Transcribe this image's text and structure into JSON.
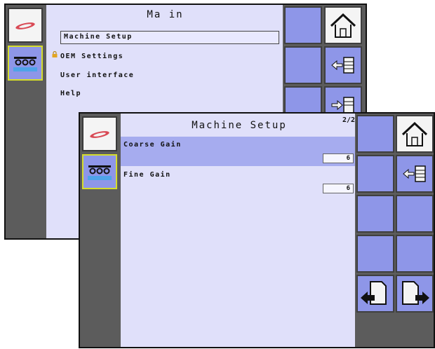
{
  "back_screen": {
    "title": "Ma in",
    "menu": [
      {
        "label": "Machine Setup",
        "selected": true,
        "locked": false
      },
      {
        "label": "OEM Settings",
        "selected": false,
        "locked": true
      },
      {
        "label": "User interface",
        "selected": false,
        "locked": false
      },
      {
        "label": "Help",
        "selected": false,
        "locked": false
      }
    ],
    "left_icons": [
      "sprayer-logo-icon",
      "boom-nozzles-icon"
    ],
    "right_icons": [
      "home-icon",
      "collapse-list-icon",
      "expand-list-icon"
    ]
  },
  "front_screen": {
    "title": "Machine Setup",
    "page_indicator": "2/2",
    "params": [
      {
        "label": "Coarse Gain",
        "value": "6",
        "selected": true
      },
      {
        "label": "Fine Gain",
        "value": "6",
        "selected": false
      }
    ],
    "left_icons": [
      "sprayer-logo-icon",
      "boom-nozzles-icon"
    ],
    "right_icons": [
      "home-icon",
      "collapse-list-icon",
      "page-back-icon",
      "page-forward-icon"
    ]
  },
  "colors": {
    "content_bg": "#e0e0fa",
    "button_blue": "#8e96e8",
    "selected_row": "#a6acef",
    "frame_gray": "#5c5c5c",
    "active_border": "#d6dd2c"
  }
}
